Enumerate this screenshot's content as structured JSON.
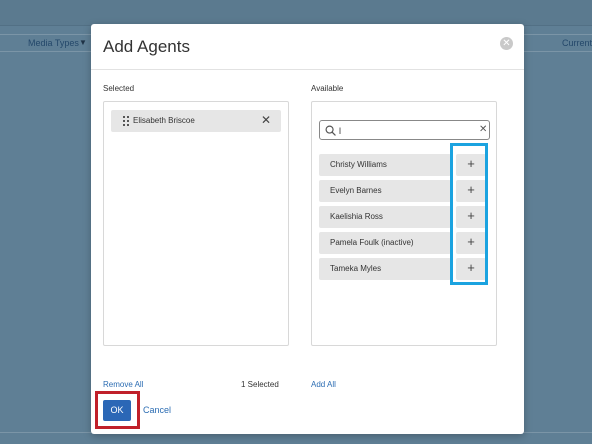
{
  "background": {
    "columns": [
      "Media Types",
      "Current"
    ]
  },
  "modal": {
    "title": "Add Agents",
    "selected": {
      "label": "Selected",
      "items": [
        "Elisabeth Briscoe"
      ],
      "remove_all": "Remove All",
      "count_text": "1 Selected"
    },
    "available": {
      "label": "Available",
      "search_value": "l",
      "items": [
        "Christy Williams",
        "Evelyn Barnes",
        "Kaelishia Ross",
        "Pamela Foulk (inactive)",
        "Tameka Myles"
      ],
      "add_all": "Add All"
    },
    "ok_label": "OK",
    "cancel_label": "Cancel"
  },
  "icons": {
    "add": "plus-icon",
    "remove": "close-icon",
    "search": "search-icon",
    "drag": "drag-handle-icon",
    "filter": "filter-icon"
  },
  "colors": {
    "primary": "#2b67b6",
    "link": "#2c6db3",
    "highlight_blue": "#1ba3e0",
    "highlight_red": "#c0202a"
  }
}
